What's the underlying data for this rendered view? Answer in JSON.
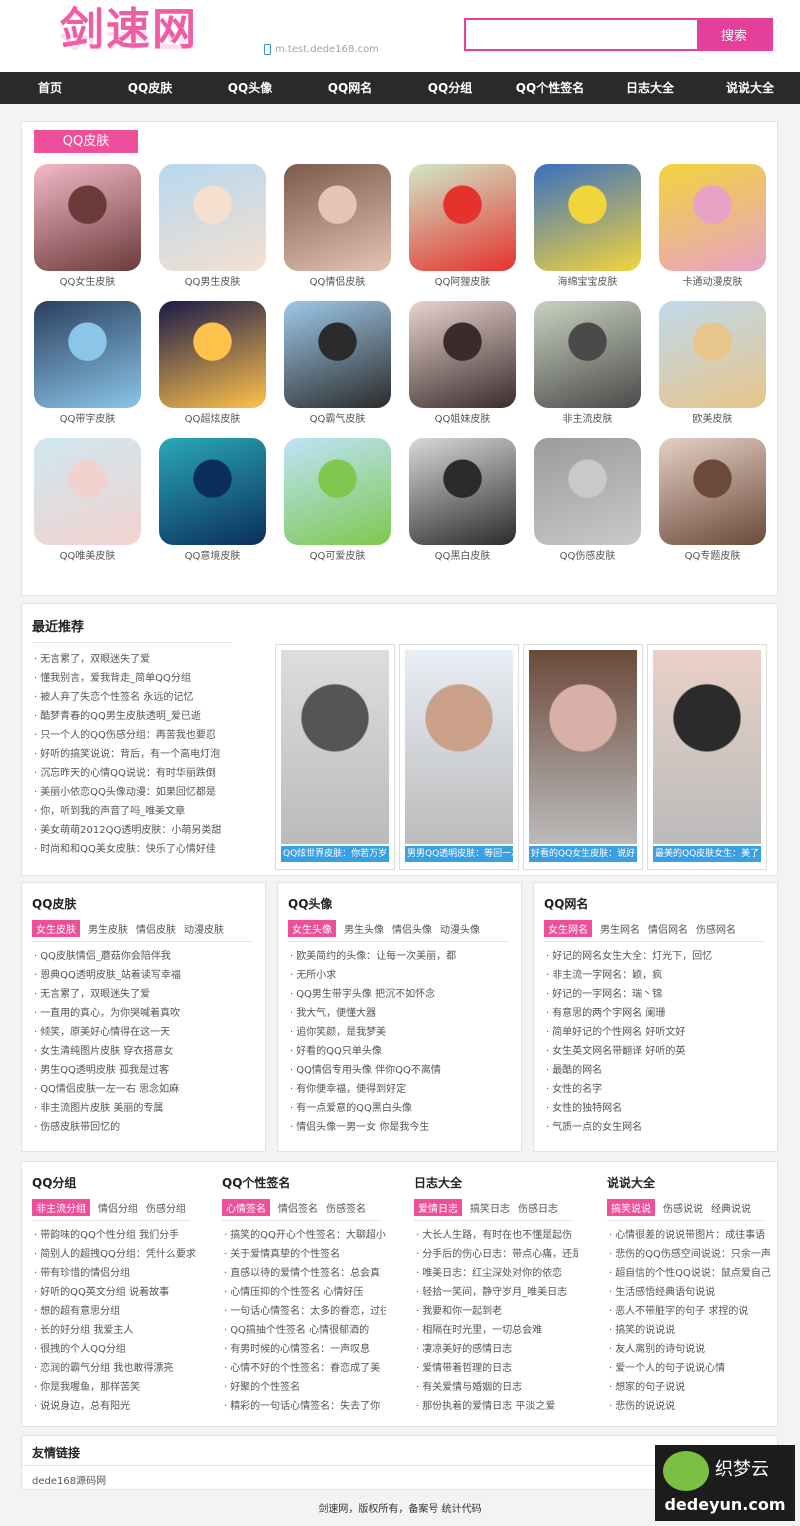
{
  "header": {
    "logo_text": "剑速网",
    "mobile_text": "m.test.dede168.com",
    "search_placeholder": "",
    "search_button": "搜索"
  },
  "nav": [
    "首页",
    "QQ皮肤",
    "QQ头像",
    "QQ网名",
    "QQ分组",
    "QQ个性签名",
    "日志大全",
    "说说大全"
  ],
  "skins": {
    "title": "QQ皮肤",
    "items": [
      "QQ女生皮肤",
      "QQ男生皮肤",
      "QQ情侣皮肤",
      "QQ阿狸皮肤",
      "海绵宝宝皮肤",
      "卡通动漫皮肤",
      "QQ带字皮肤",
      "QQ超炫皮肤",
      "QQ霸气皮肤",
      "QQ姐妹皮肤",
      "非主流皮肤",
      "欧美皮肤",
      "QQ唯美皮肤",
      "QQ意境皮肤",
      "QQ可爱皮肤",
      "QQ黑白皮肤",
      "QQ伤感皮肤",
      "QQ专题皮肤"
    ]
  },
  "recent": {
    "title": "最近推荐",
    "items": [
      "无言累了，双眼迷失了爱",
      "懂我别言，爱我背走_简单QQ分组",
      "被人弃了失恋个性签名 永远的记忆",
      "酷梦青春的QQ男生皮肤透明_爱已逝",
      "只一个人的QQ伤感分组：再苦我也要忍",
      "好听的搞笑说说：背后，有一个高电灯泡",
      "沉忘昨天的心情QQ说说：有时华丽跌倒",
      "美丽小依恋QQ头像动漫：如果回忆都是",
      "你，听到我的声音了吗_唯美文章",
      "美女萌萌2012QQ透明皮肤：小萌另类甜",
      "时尚和和QQ美女皮肤：快乐了心情好佳"
    ],
    "cards": [
      "QQ炫世界皮肤：你若万岁",
      "男男QQ透明皮肤：等回一次",
      "好看的QQ女生皮肤：说好",
      "最美的QQ皮肤女生：美了"
    ]
  },
  "boxes_row1": [
    {
      "title": "QQ皮肤",
      "tabs": [
        "女生皮肤",
        "男生皮肤",
        "情侣皮肤",
        "动漫皮肤"
      ],
      "items": [
        "QQ皮肤情侣_蘑菇你会陪伴我",
        "恩典QQ透明皮肤_站着读写幸福",
        "无言累了，双眼迷失了爱",
        "一直用的真心，为你哭喊着真吹",
        "倾笑，原美好心情得在这一天",
        "女生清纯图片皮肤 穿衣搭意女",
        "男生QQ透明皮肤 孤我是过客",
        "QQ情侣皮肤一左一右 思念如麻",
        "非主流图片皮肤 美丽的专属",
        "伤感皮肤带回忆的"
      ]
    },
    {
      "title": "QQ头像",
      "tabs": [
        "女生头像",
        "男生头像",
        "情侣头像",
        "动漫头像"
      ],
      "items": [
        "欧美简约的头像：让每一次美丽，都",
        "无所小求",
        "QQ男生带字头像 把沉不如怀念",
        "我大气，便懂大器",
        "追你笑颜，是我梦美",
        "好看的QQ只单头像",
        "QQ情侣专用头像 伴你QQ不离情",
        "有你便幸福，便得到好定",
        "有一点爱意的QQ黑白头像",
        "情侣头像一男一女 你是我今生"
      ]
    },
    {
      "title": "QQ网名",
      "tabs": [
        "女生网名",
        "男生网名",
        "情侣网名",
        "伤感网名"
      ],
      "items": [
        "好记的网名女生大全：灯光下，回忆",
        "非主流一字网名：颖，疯",
        "好记的一字网名：瑞丶锦",
        "有意思的两个字网名 阑珊",
        "简单好记的个性网名 好听文好",
        "女生英文网名带翻译 好听的英",
        "最酷的网名",
        "女性的名字",
        "女性的独特网名",
        "气质一点的女生网名"
      ]
    }
  ],
  "boxes_row2": [
    {
      "title": "QQ分组",
      "tabs": [
        "非主流分组",
        "情侣分组",
        "伤感分组"
      ],
      "items": [
        "带韵味的QQ个性分组 我们分手",
        "简别人的超拽QQ分组：凭什么要求",
        "带有珍惜的情侣分组",
        "好听的QQ英文分组 说着故事",
        "想的超有意思分组",
        "长的好分组 我爱主人",
        "很拽的个人QQ分组",
        "恋润的霸气分组 我也敢得漂亮",
        "你是我喔鱼，那样苦笑",
        "说说身边，总有阳光"
      ]
    },
    {
      "title": "QQ个性签名",
      "tabs": [
        "心情签名",
        "情侣签名",
        "伤感签名"
      ],
      "items": [
        "搞笑的QQ开心个性签名：大聊超小",
        "关于爱情真挚的个性签名",
        "直感以待的爱情个性签名：总会真",
        "心情压抑的个性签名 心情好压",
        "一句话心情签名：太多的眷恋，过往",
        "QQ搞抽个性签名 心情很郁酒的",
        "有男时候的心情签名：一声叹息",
        "心情不好的个性签名：眷恋成了美",
        "好聚的个性签名",
        "精彩的一句话心情签名：失去了你"
      ]
    },
    {
      "title": "日志大全",
      "tabs": [
        "爱情日志",
        "搞笑日志",
        "伤感日志"
      ],
      "items": [
        "大长人生路，有时在也不懂是起伤",
        "分手后的伤心日志：带点心痛，还是",
        "唯美日志：红尘深处对你的依恋",
        "轻拾一笑间，静守岁月_唯美日志",
        "我要和你一起到老",
        "相隔在时光里，一切总会难",
        "凄凉美好的感情日志",
        "爱情带着哲理的日志",
        "有关爱情与婚姻的日志",
        "那份执着的爱情日志 平淡之爱"
      ]
    },
    {
      "title": "说说大全",
      "tabs": [
        "搞笑说说",
        "伤感说说",
        "经典说说"
      ],
      "items": [
        "心情很差的说说带图片：成往事语",
        "悲伤的QQ伤感空间说说：只余一声",
        "超自信的个性QQ说说：鼠点爱自己",
        "生活感悟经典语句说说",
        "恶人不带脏字的句子 求捏的说",
        "搞笑的说说说",
        "友人离别的诗句说说",
        "爱一个人的句子说说心情",
        "想家的句子说说",
        "悲伤的说说说"
      ]
    }
  ],
  "links": {
    "title": "友情链接",
    "items": [
      "dede168源码网"
    ]
  },
  "footer": "剑速网，版权所有，备案号 统计代码",
  "watermark": {
    "name": "织梦云",
    "url": "dedeyun.com"
  }
}
